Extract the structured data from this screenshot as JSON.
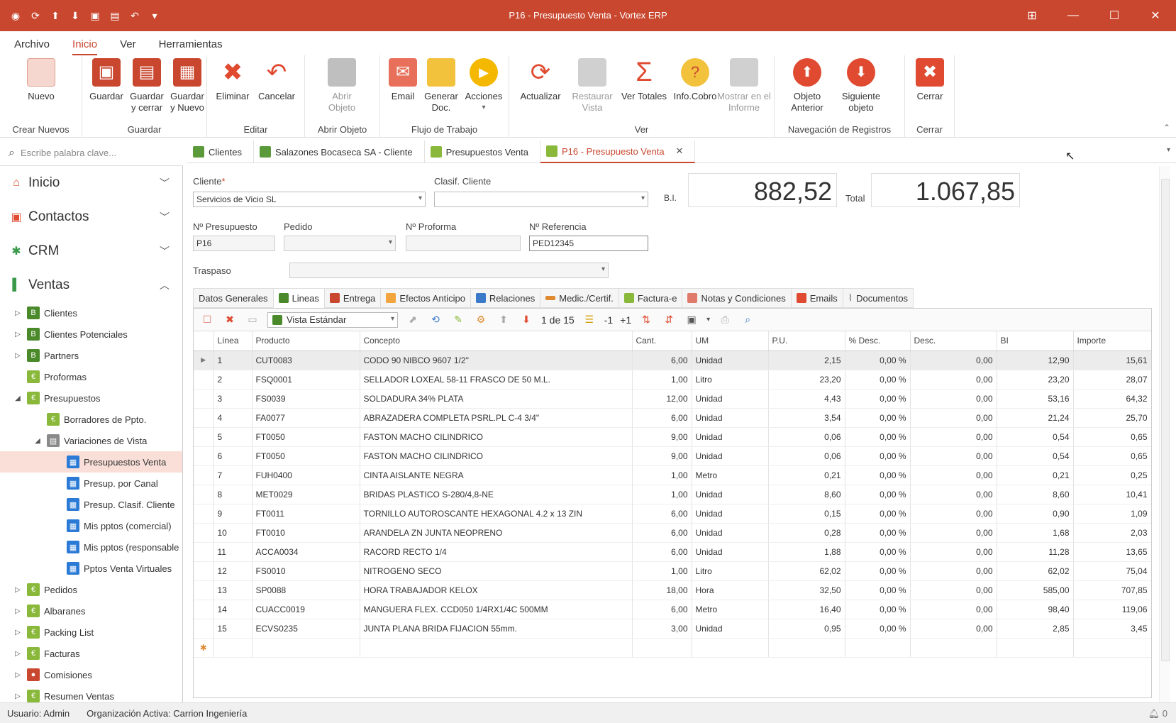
{
  "window": {
    "title": "P16 - Presupuesto Venta - Vortex ERP"
  },
  "menu": [
    "Archivo",
    "Inicio",
    "Ver",
    "Herramientas"
  ],
  "ribbon": {
    "groups": {
      "crear": "Crear Nuevos",
      "guardar": "Guardar",
      "editar": "Editar",
      "abrir": "Abrir Objeto",
      "flujo": "Flujo de Trabajo",
      "ver": "Ver",
      "nav": "Navegación de Registros",
      "cerrar": "Cerrar"
    },
    "buttons": {
      "nuevo": "Nuevo",
      "guardar": "Guardar",
      "guardar_cerrar": "Guardar y cerrar",
      "guardar_nuevo": "Guardar y Nuevo",
      "eliminar": "Eliminar",
      "cancelar": "Cancelar",
      "abrir_objeto": "Abrir Objeto",
      "email": "Email",
      "generar_doc": "Generar Doc.",
      "acciones": "Acciones",
      "actualizar": "Actualizar",
      "restaurar_vista": "Restaurar Vista",
      "ver_totales": "Ver Totales",
      "info_cobro": "Info.Cobro",
      "mostrar_informe": "Mostrar en el Informe",
      "objeto_anterior": "Objeto Anterior",
      "siguiente_objeto": "Siguiente objeto",
      "cerrar": "Cerrar"
    }
  },
  "search": {
    "placeholder": "Escribe palabra clave..."
  },
  "sidebar": {
    "sections": {
      "inicio": "Inicio",
      "contactos": "Contactos",
      "crm": "CRM",
      "ventas": "Ventas"
    },
    "items": {
      "clientes": "Clientes",
      "clientes_potenciales": "Clientes Potenciales",
      "partners": "Partners",
      "proformas": "Proformas",
      "presupuestos": "Presupuestos",
      "borradores": "Borradores de Ppto.",
      "variaciones": "Variaciones de Vista",
      "presupuestos_venta": "Presupuestos Venta",
      "presup_canal": "Presup. por Canal",
      "presup_clasif": "Presup. Clasif. Cliente",
      "mis_pptos_comercial": "Mis pptos (comercial)",
      "mis_pptos_responsable": "Mis pptos (responsable",
      "pptos_virtuales": "Pptos Venta Virtuales",
      "pedidos": "Pedidos",
      "albaranes": "Albaranes",
      "packing": "Packing List",
      "facturas": "Facturas",
      "comisiones": "Comisiones",
      "resumen": "Resumen Ventas"
    }
  },
  "tabs": [
    "Clientes",
    "Salazones Bocaseca SA - Cliente",
    "Presupuestos Venta",
    "P16 - Presupuesto Venta"
  ],
  "form": {
    "cliente_label": "Cliente",
    "cliente_req": "*",
    "cliente_value": "Servicios de Vicio SL",
    "clasif_label": "Clasif. Cliente",
    "clasif_value": "",
    "bi_label": "B.I.",
    "bi_value": "882,52",
    "total_label": "Total",
    "total_value": "1.067,85",
    "npresupuesto_label": "Nº Presupuesto",
    "npresupuesto_value": "P16",
    "pedido_label": "Pedido",
    "pedido_value": "",
    "nproforma_label": "Nº Proforma",
    "nproforma_value": "",
    "nreferencia_label": "Nº Referencia",
    "nreferencia_value": "PED12345",
    "traspaso_label": "Traspaso",
    "traspaso_value": ""
  },
  "subtabs": [
    "Datos Generales",
    "Lineas",
    "Entrega",
    "Efectos Anticipo",
    "Relaciones",
    "Medic./Certif.",
    "Factura-e",
    "Notas y Condiciones",
    "Emails",
    "Documentos"
  ],
  "grid": {
    "view": "Vista Estándar",
    "pager": "1 de 15",
    "minus": "-1",
    "plus": "+1",
    "columns": [
      "Línea",
      "Producto",
      "Concepto",
      "Cant.",
      "UM",
      "P.U.",
      "% Desc.",
      "Desc.",
      "BI",
      "Importe"
    ],
    "rows": [
      [
        "1",
        "CUT0083",
        "CODO 90 NIBCO 9607 1/2\"",
        "6,00",
        "Unidad",
        "2,15",
        "0,00 %",
        "0,00",
        "12,90",
        "15,61"
      ],
      [
        "2",
        "FSQ0001",
        "SELLADOR LOXEAL 58-11 FRASCO DE 50 M.L.",
        "1,00",
        "Litro",
        "23,20",
        "0,00 %",
        "0,00",
        "23,20",
        "28,07"
      ],
      [
        "3",
        "FS0039",
        "SOLDADURA 34% PLATA",
        "12,00",
        "Unidad",
        "4,43",
        "0,00 %",
        "0,00",
        "53,16",
        "64,32"
      ],
      [
        "4",
        "FA0077",
        "ABRAZADERA COMPLETA PSRL.PL C-4  3/4\"",
        "6,00",
        "Unidad",
        "3,54",
        "0,00 %",
        "0,00",
        "21,24",
        "25,70"
      ],
      [
        "5",
        "FT0050",
        "FASTON MACHO CILINDRICO",
        "9,00",
        "Unidad",
        "0,06",
        "0,00 %",
        "0,00",
        "0,54",
        "0,65"
      ],
      [
        "6",
        "FT0050",
        "FASTON MACHO CILINDRICO",
        "9,00",
        "Unidad",
        "0,06",
        "0,00 %",
        "0,00",
        "0,54",
        "0,65"
      ],
      [
        "7",
        "FUH0400",
        "CINTA AISLANTE NEGRA",
        "1,00",
        "Metro",
        "0,21",
        "0,00 %",
        "0,00",
        "0,21",
        "0,25"
      ],
      [
        "8",
        "MET0029",
        "BRIDAS PLASTICO S-280/4,8-NE",
        "1,00",
        "Unidad",
        "8,60",
        "0,00 %",
        "0,00",
        "8,60",
        "10,41"
      ],
      [
        "9",
        "FT0011",
        "TORNILLO AUTOROSCANTE HEXAGONAL 4.2  x 13 ZIN",
        "6,00",
        "Unidad",
        "0,15",
        "0,00 %",
        "0,00",
        "0,90",
        "1,09"
      ],
      [
        "10",
        "FT0010",
        "ARANDELA ZN JUNTA NEOPRENO",
        "6,00",
        "Unidad",
        "0,28",
        "0,00 %",
        "0,00",
        "1,68",
        "2,03"
      ],
      [
        "11",
        "ACCA0034",
        "RACORD RECTO 1/4",
        "6,00",
        "Unidad",
        "1,88",
        "0,00 %",
        "0,00",
        "11,28",
        "13,65"
      ],
      [
        "12",
        "FS0010",
        "NITROGENO SECO",
        "1,00",
        "Litro",
        "62,02",
        "0,00 %",
        "0,00",
        "62,02",
        "75,04"
      ],
      [
        "13",
        "SP0088",
        "HORA TRABAJADOR KELOX",
        "18,00",
        "Hora",
        "32,50",
        "0,00 %",
        "0,00",
        "585,00",
        "707,85"
      ],
      [
        "14",
        "CUACC0019",
        "MANGUERA FLEX. CCD050 1/4RX1/4C 500MM",
        "6,00",
        "Metro",
        "16,40",
        "0,00 %",
        "0,00",
        "98,40",
        "119,06"
      ],
      [
        "15",
        "ECVS0235",
        "JUNTA PLANA BRIDA FIJACION 55mm.",
        "3,00",
        "Unidad",
        "0,95",
        "0,00 %",
        "0,00",
        "2,85",
        "3,45"
      ]
    ]
  },
  "status": {
    "user": "Usuario: Admin",
    "org": "Organización Activa: Carrion Ingeniería",
    "notif": "0"
  }
}
